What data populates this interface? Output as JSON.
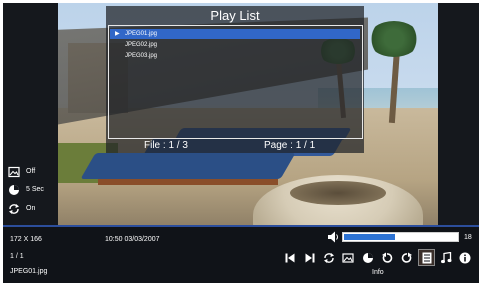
{
  "playlist": {
    "title": "Play List",
    "items": [
      {
        "label": "JPEG01.jpg",
        "selected": true
      },
      {
        "label": "JPEG02.jpg",
        "selected": false
      },
      {
        "label": "JPEG03.jpg",
        "selected": false
      }
    ],
    "file_text": "File : 1 / 3",
    "page_text": "Page : 1 / 1"
  },
  "side": {
    "display_value": "Off",
    "interval_value": "5 Sec",
    "repeat_value": "On"
  },
  "info": {
    "resolution": "172 X 166",
    "datetime": "10:50 03/03/2007",
    "index": "1 / 1",
    "filename": "JPEG01.jpg"
  },
  "volume": {
    "value": "18",
    "level": 0.45
  },
  "controls": {
    "info_label": "Info",
    "icons": [
      "previous-icon",
      "next-icon",
      "repeat-icon",
      "image-icon",
      "clock-icon",
      "rotate-left-icon",
      "rotate-right-icon",
      "playlist-icon",
      "music-icon",
      "info-icon"
    ]
  },
  "colors": {
    "selection": "#3167c8",
    "bar_accent": "#2c4e9c",
    "progress": "#2d73d4"
  }
}
